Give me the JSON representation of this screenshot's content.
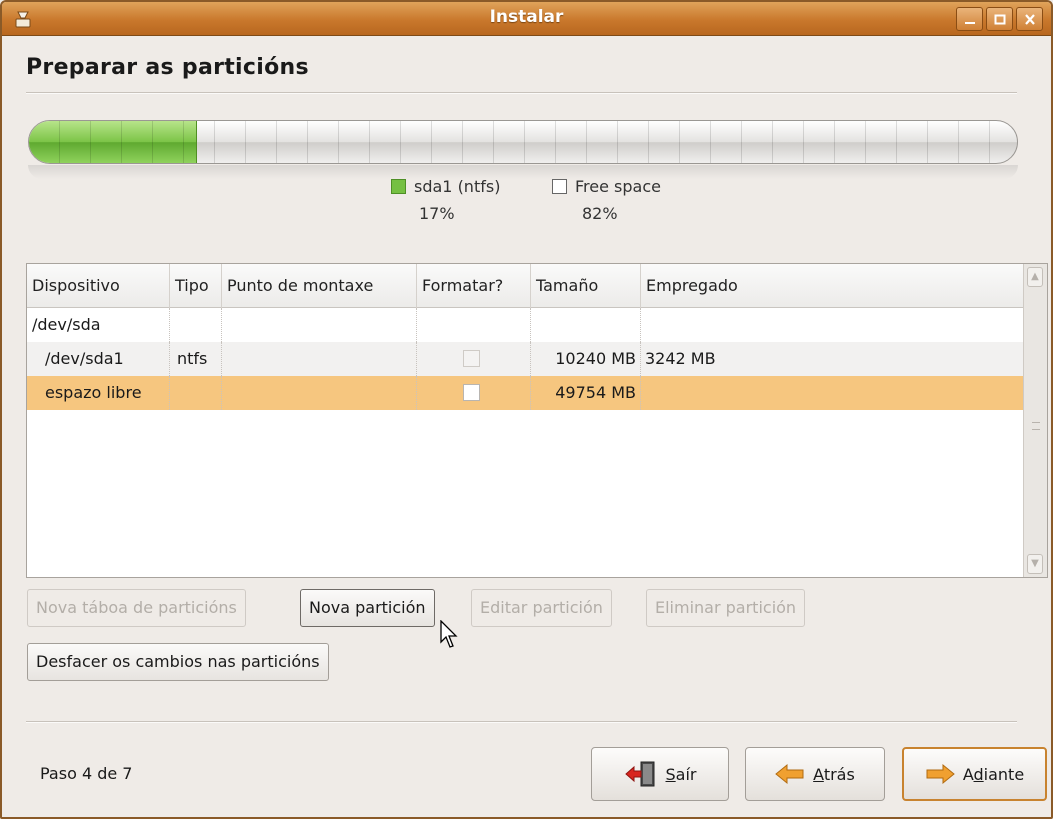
{
  "window": {
    "title": "Instalar",
    "controls": [
      "minimize-icon",
      "maximize-icon",
      "close-icon"
    ]
  },
  "page": {
    "heading": "Preparar as particións"
  },
  "partition_bar": {
    "used_fraction": 0.17,
    "colors": {
      "used": "#75c042",
      "free": "#ffffff"
    },
    "legend": [
      {
        "name": "sda1 (ntfs)",
        "percent": "17%",
        "color": "#75c042"
      },
      {
        "name": "Free space",
        "percent": "82%",
        "color": "#ffffff"
      }
    ]
  },
  "table": {
    "columns": [
      "Dispositivo",
      "Tipo",
      "Punto de montaxe",
      "Formatar?",
      "Tamaño",
      "Empregado"
    ],
    "rows": [
      {
        "device": "/dev/sda",
        "type": "",
        "mount": "",
        "format": null,
        "size": "",
        "used": ""
      },
      {
        "device": "/dev/sda1",
        "type": "ntfs",
        "mount": "",
        "format": false,
        "size": "10240 MB",
        "used": "3242 MB"
      },
      {
        "device": "espazo libre",
        "type": "",
        "mount": "",
        "format": false,
        "size": "49754 MB",
        "used": "",
        "selected": true
      }
    ],
    "selected_color": "#f6c67f"
  },
  "partition_buttons": {
    "new_table": "Nova táboa de particións",
    "new_partition": "Nova partición",
    "edit_partition": "Editar partición",
    "delete_partition": "Eliminar partición",
    "undo_changes": "Desfacer os cambios nas particións"
  },
  "footer": {
    "step": "Paso 4 de 7",
    "quit": {
      "prefix": "",
      "mnemonic": "S",
      "rest": "aír"
    },
    "back": {
      "prefix": "",
      "mnemonic": "A",
      "rest": "trás"
    },
    "forward": {
      "prefix": "A",
      "mnemonic": "d",
      "rest": "iante"
    }
  }
}
